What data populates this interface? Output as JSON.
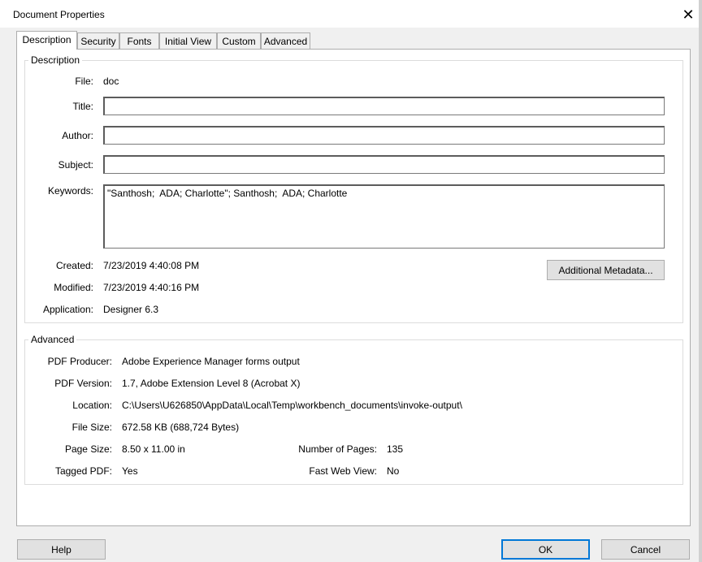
{
  "window": {
    "title": "Document Properties",
    "close_glyph": "✕"
  },
  "tabs": [
    {
      "label": "Description",
      "active": true
    },
    {
      "label": "Security"
    },
    {
      "label": "Fonts"
    },
    {
      "label": "Initial View"
    },
    {
      "label": "Custom"
    },
    {
      "label": "Advanced"
    }
  ],
  "description": {
    "group_label": "Description",
    "file_label": "File:",
    "file_value": "doc",
    "title_label": "Title:",
    "title_value": "",
    "author_label": "Author:",
    "author_value": "",
    "subject_label": "Subject:",
    "subject_value": "",
    "keywords_label": "Keywords:",
    "keywords_value": "\"Santhosh;  ADA; Charlotte\"; Santhosh;  ADA; Charlotte",
    "created_label": "Created:",
    "created_value": "7/23/2019 4:40:08 PM",
    "modified_label": "Modified:",
    "modified_value": "7/23/2019 4:40:16 PM",
    "application_label": "Application:",
    "application_value": "Designer 6.3",
    "metadata_button": "Additional Metadata..."
  },
  "advanced": {
    "group_label": "Advanced",
    "producer_label": "PDF Producer:",
    "producer_value": "Adobe Experience Manager forms output",
    "version_label": "PDF Version:",
    "version_value": "1.7, Adobe Extension Level 8 (Acrobat X)",
    "location_label": "Location:",
    "location_value": "C:\\Users\\U626850\\AppData\\Local\\Temp\\workbench_documents\\invoke-output\\",
    "filesize_label": "File Size:",
    "filesize_value": "672.58 KB (688,724 Bytes)",
    "pagesize_label": "Page Size:",
    "pagesize_value": "8.50 x 11.00 in",
    "pages_label": "Number of Pages:",
    "pages_value": "135",
    "tagged_label": "Tagged PDF:",
    "tagged_value": "Yes",
    "fastweb_label": "Fast Web View:",
    "fastweb_value": "No"
  },
  "footer": {
    "help": "Help",
    "ok": "OK",
    "cancel": "Cancel"
  },
  "colors": {
    "default_button_border": "#0078d7",
    "panel_bg": "#ffffff",
    "dialog_bg": "#f0f0f0"
  }
}
